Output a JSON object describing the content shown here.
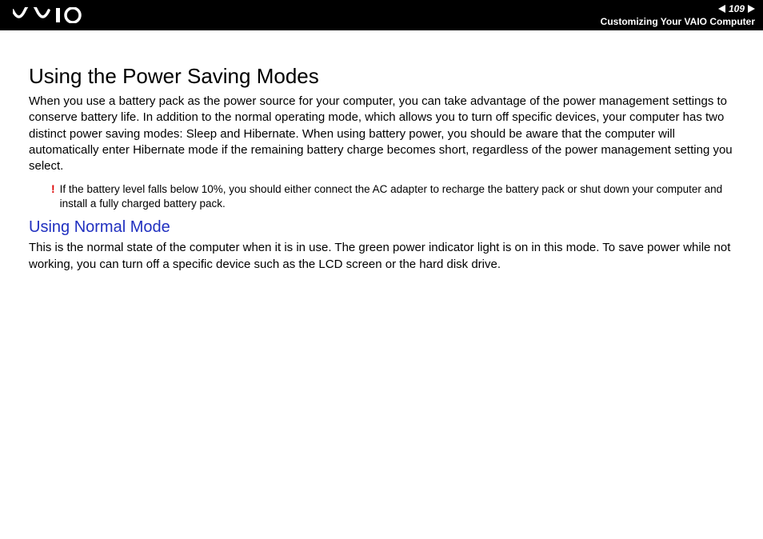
{
  "header": {
    "page_number": "109",
    "section_title": "Customizing Your VAIO Computer"
  },
  "main": {
    "heading": "Using the Power Saving Modes",
    "intro": "When you use a battery pack as the power source for your computer, you can take advantage of the power management settings to conserve battery life. In addition to the normal operating mode, which allows you to turn off specific devices, your computer has two distinct power saving modes: Sleep and Hibernate. When using battery power, you should be aware that the computer will automatically enter Hibernate mode if the remaining battery charge becomes short, regardless of the power management setting you select.",
    "warning_mark": "!",
    "warning_text": "If the battery level falls below 10%, you should either connect the AC adapter to recharge the battery pack or shut down your computer and install a fully charged battery pack.",
    "subheading": "Using Normal Mode",
    "sub_body": "This is the normal state of the computer when it is in use. The green power indicator light is on in this mode. To save power while not working, you can turn off a specific device such as the LCD screen or the hard disk drive."
  }
}
